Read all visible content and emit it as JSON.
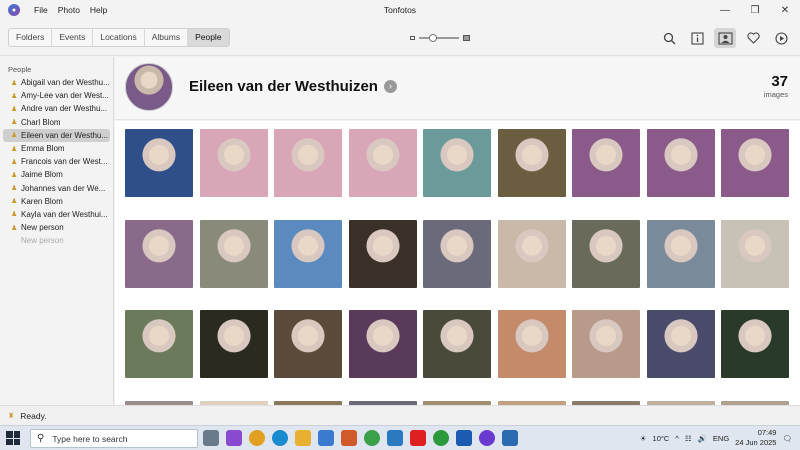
{
  "window": {
    "title": "Tonfotos",
    "menu": [
      "File",
      "Photo",
      "Help"
    ]
  },
  "toolbar": {
    "tabs": [
      {
        "label": "Folders",
        "active": false
      },
      {
        "label": "Events",
        "active": false
      },
      {
        "label": "Locations",
        "active": false
      },
      {
        "label": "Albums",
        "active": false
      },
      {
        "label": "People",
        "active": true
      }
    ],
    "zoom_level": 0.3,
    "icons": [
      "search-icon",
      "info-icon",
      "faces-icon",
      "heart-icon",
      "play-icon"
    ]
  },
  "sidebar": {
    "heading": "People",
    "items": [
      {
        "label": "Abigail van der Westhu..."
      },
      {
        "label": "Amy-Lee van der West..."
      },
      {
        "label": "Andre van der Westhu..."
      },
      {
        "label": "Charl Blom"
      },
      {
        "label": "Eileen van der Westhu...",
        "active": true
      },
      {
        "label": "Emma Blom"
      },
      {
        "label": "Francois van der West..."
      },
      {
        "label": "Jaime Blom"
      },
      {
        "label": "Johannes van der We..."
      },
      {
        "label": "Karen Blom"
      },
      {
        "label": "Kayla van der Westhui..."
      },
      {
        "label": "New person"
      },
      {
        "label": "New person",
        "faded": true
      }
    ]
  },
  "person": {
    "name": "Eileen van der Westhuizen",
    "count": "37",
    "count_label": "images"
  },
  "photos": {
    "rows": 4,
    "colors": [
      [
        "#2f4f8a",
        "#d9a6b8",
        "#d9a6b8",
        "#d9a6b8",
        "#6a9a9a",
        "#6b5d3f",
        "#8a5a8a",
        "#8a5a8a",
        "#8a5a8a"
      ],
      [
        "#8a6a8a",
        "#8a8a7a",
        "#5a8ac0",
        "#3a3028",
        "#6a6a7a",
        "#c9b9a9",
        "#6a6a5a",
        "#7a8a9a",
        "#c8c2b6"
      ],
      [
        "#6a7a5a",
        "#2a2a20",
        "#5a4a3a",
        "#5a3a5a",
        "#4a4a3a",
        "#c58a6a",
        "#b89a8a",
        "#4a4a6a",
        "#2a3a2a"
      ],
      [
        "#9a8a8a",
        "#e0d0c0",
        "#8a7a5a",
        "#6a6a7a",
        "#a09070",
        "#c0a080",
        "#8a7a6a",
        "#c0b0a0",
        "#b0a090"
      ]
    ]
  },
  "status": {
    "text": "Ready."
  },
  "taskbar": {
    "search_placeholder": "Type here to search",
    "weather": "10°C",
    "language": "ENG",
    "time": "07:49",
    "date": "24 Jun 2025"
  }
}
